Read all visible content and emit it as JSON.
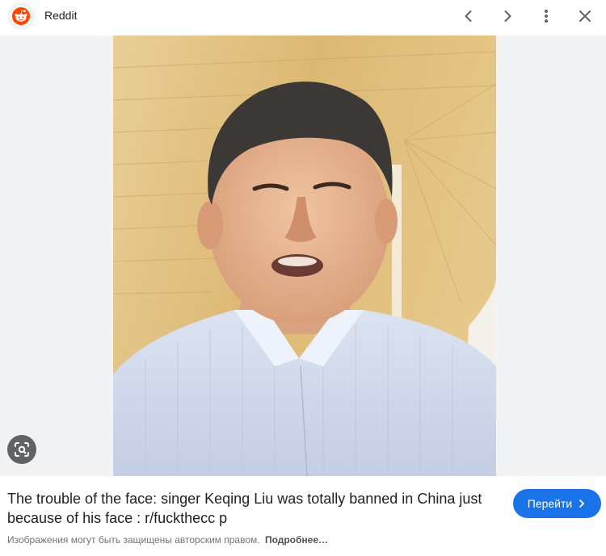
{
  "header": {
    "site_name": "Reddit",
    "logo_icon": "reddit-logo-icon",
    "buttons": {
      "prev_icon": "chevron-left-icon",
      "next_icon": "chevron-right-icon",
      "more_icon": "more-vert-icon",
      "close_icon": "close-icon"
    }
  },
  "image": {
    "lens_icon": "google-lens-icon"
  },
  "result": {
    "title": "The trouble of the face: singer Keqing Liu was totally banned in China just because of his face : r/fuckthecc p",
    "visit_label": "Перейти",
    "visit_icon": "chevron-right-icon",
    "copyright_note": "Изображения могут быть защищены авторским правом.",
    "more_link": "Подробнее…"
  },
  "colors": {
    "accent": "#1a73e8",
    "reddit_orange": "#ff4500",
    "stage_bg": "#f1f3f4"
  }
}
